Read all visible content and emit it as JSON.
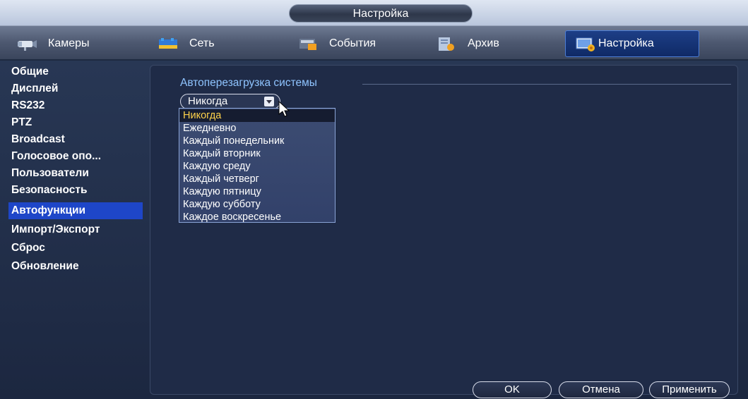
{
  "window": {
    "title": "Настройка"
  },
  "tabs": [
    {
      "label": "Камеры",
      "icon": "camera-icon"
    },
    {
      "label": "Сеть",
      "icon": "network-icon"
    },
    {
      "label": "События",
      "icon": "events-icon"
    },
    {
      "label": "Архив",
      "icon": "archive-icon"
    },
    {
      "label": "Настройка",
      "icon": "settings-icon"
    }
  ],
  "sidebar": {
    "items": [
      {
        "label": "Общие"
      },
      {
        "label": "Дисплей"
      },
      {
        "label": "RS232"
      },
      {
        "label": "PTZ"
      },
      {
        "label": "Broadcast"
      },
      {
        "label": "Голосовое опо..."
      },
      {
        "label": "Пользователи"
      },
      {
        "label": "Безопасность"
      },
      {
        "label": "Автофункции"
      },
      {
        "label": "Импорт/Экспорт"
      },
      {
        "label": "Сброс"
      },
      {
        "label": "Обновление"
      }
    ],
    "active_index": 8
  },
  "main": {
    "section_title": "Автоперезагрузка системы",
    "reboot_select": {
      "value": "Никогда"
    },
    "reboot_options": [
      "Никогда",
      "Ежедневно",
      "Каждый понедельник",
      "Каждый вторник",
      "Каждую среду",
      "Каждый четверг",
      "Каждую пятницу",
      "Каждую субботу",
      "Каждое воскресенье"
    ]
  },
  "buttons": {
    "ok": "OK",
    "cancel": "Отмена",
    "apply": "Применить"
  },
  "colors": {
    "accent_blue": "#1e46c8",
    "selected_text": "#ffd24a",
    "section_title": "#8fc4ff"
  }
}
